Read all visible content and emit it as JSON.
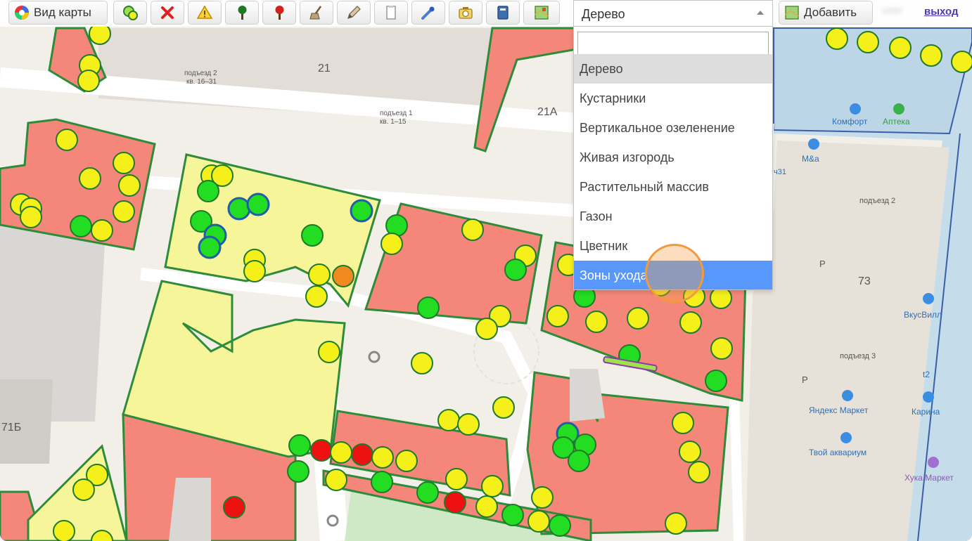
{
  "toolbar": {
    "map_view_label": "Вид карты",
    "add_label": "Добавить",
    "exit_label": "выход",
    "buttons": [
      {
        "name": "add-tree-icon"
      },
      {
        "name": "delete-icon"
      },
      {
        "name": "warning-icon"
      },
      {
        "name": "tree-marker-icon"
      },
      {
        "name": "tree-marker-red-icon"
      },
      {
        "name": "broom-icon"
      },
      {
        "name": "edit-icon"
      },
      {
        "name": "document-icon"
      },
      {
        "name": "pipette-icon"
      },
      {
        "name": "camera-icon"
      },
      {
        "name": "notebook-icon"
      },
      {
        "name": "map-export-icon"
      }
    ]
  },
  "select": {
    "value": "Дерево",
    "search_value": "",
    "options": [
      {
        "label": "Дерево",
        "state": "selected"
      },
      {
        "label": "Кустарники",
        "state": ""
      },
      {
        "label": "Вертикальное озеленение",
        "state": ""
      },
      {
        "label": "Живая изгородь",
        "state": ""
      },
      {
        "label": "Растительный массив",
        "state": ""
      },
      {
        "label": "Газон",
        "state": ""
      },
      {
        "label": "Цветник",
        "state": ""
      },
      {
        "label": "Зоны ухода",
        "state": "highlighted"
      }
    ]
  },
  "map": {
    "labels": [
      {
        "name": "building-number",
        "text": "21"
      },
      {
        "name": "building-number",
        "text": "21А"
      },
      {
        "name": "building-number",
        "text": "73"
      },
      {
        "name": "building-number",
        "text": "71Б"
      },
      {
        "name": "entrance-label",
        "text": "подъезд 2"
      },
      {
        "name": "entrance-label",
        "text": "кв. 16–31"
      },
      {
        "name": "entrance-label",
        "text": "подъезд 1"
      },
      {
        "name": "entrance-label",
        "text": "кв. 1–15"
      },
      {
        "name": "entrance-label",
        "text": "подъезд 2"
      },
      {
        "name": "entrance-label",
        "text": "подъезд 3"
      },
      {
        "name": "poi-label",
        "text": "Комфорт"
      },
      {
        "name": "poi-label",
        "text": "Аптека"
      },
      {
        "name": "poi-label",
        "text": "М&а"
      },
      {
        "name": "poi-label",
        "text": "ВкусВилл"
      },
      {
        "name": "poi-label",
        "text": "Яндекс Маркет"
      },
      {
        "name": "poi-label",
        "text": "Карина"
      },
      {
        "name": "poi-label",
        "text": "Твой аквариум"
      },
      {
        "name": "poi-label",
        "text": "Хука Маркет"
      },
      {
        "name": "poi-label",
        "text": "t2"
      },
      {
        "name": "parking-label",
        "text": "P"
      },
      {
        "name": "parking-label",
        "text": "P"
      },
      {
        "name": "address-label",
        "text": "ч31"
      }
    ]
  },
  "colors": {
    "zone_red": "#f4877a",
    "zone_yellow": "#f7f59a",
    "zone_border": "#2e8b3a",
    "tree_yellow": "#f5f01a",
    "tree_green": "#22dd22",
    "tree_red": "#ee1111",
    "tree_orange": "#f08a1e",
    "dropdown_highlight": "#5897fb"
  }
}
